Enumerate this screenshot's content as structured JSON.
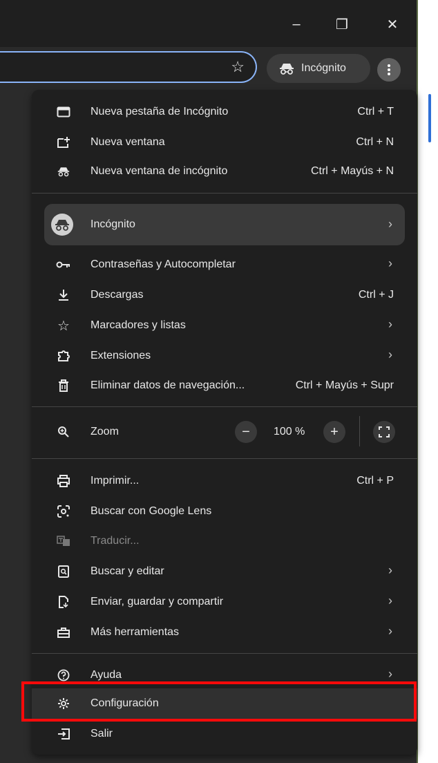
{
  "window": {
    "minimize_symbol": "–",
    "restore_symbol": "❐",
    "close_symbol": "✕"
  },
  "toolbar": {
    "profile_chip_label": "Incógnito",
    "bookmark_icon": "star-icon",
    "menu_icon": "kebab-icon"
  },
  "menu": {
    "group1": [
      {
        "label": "Nueva pestaña de Incógnito",
        "shortcut": "Ctrl + T"
      },
      {
        "label": "Nueva ventana",
        "shortcut": "Ctrl + N"
      },
      {
        "label": "Nueva ventana de incógnito",
        "shortcut": "Ctrl + Mayús + N"
      }
    ],
    "profile": {
      "label": "Incógnito",
      "chevron": "›"
    },
    "group2": [
      {
        "label": "Contraseñas y Autocompletar",
        "chevron": "›"
      },
      {
        "label": "Descargas",
        "shortcut": "Ctrl + J"
      },
      {
        "label": "Marcadores y listas",
        "chevron": "›"
      },
      {
        "label": "Extensiones",
        "chevron": "›"
      },
      {
        "label": "Eliminar datos de navegación...",
        "shortcut": "Ctrl + Mayús + Supr"
      }
    ],
    "zoom": {
      "label": "Zoom",
      "minus": "−",
      "value": "100 %",
      "plus": "+"
    },
    "group3": [
      {
        "label": "Imprimir...",
        "shortcut": "Ctrl + P"
      },
      {
        "label": "Buscar con Google Lens"
      },
      {
        "label": "Traducir..."
      },
      {
        "label": "Buscar y editar",
        "chevron": "›"
      },
      {
        "label": "Enviar, guardar y compartir",
        "chevron": "›"
      },
      {
        "label": "Más herramientas",
        "chevron": "›"
      }
    ],
    "group4": [
      {
        "label": "Ayuda",
        "chevron": "›"
      },
      {
        "label": "Configuración"
      },
      {
        "label": "Salir"
      }
    ]
  },
  "colors": {
    "menu_bg": "#1f1f1f",
    "text": "#e8e8e8",
    "accent": "#8ab4f8",
    "highlight_box": "#ff0a0a"
  }
}
